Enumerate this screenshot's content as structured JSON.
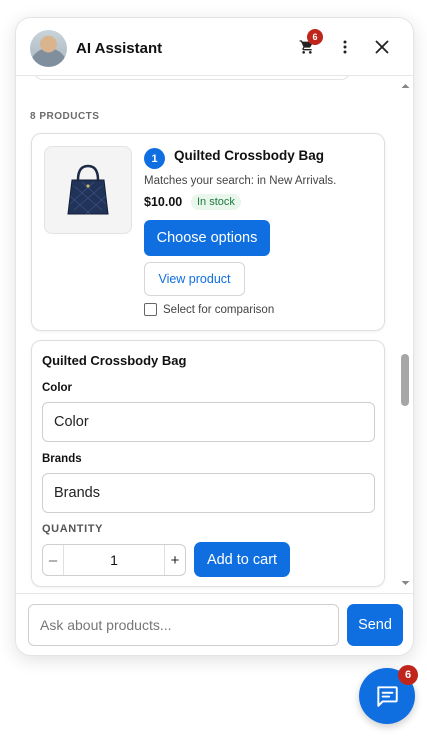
{
  "header": {
    "title": "AI Assistant",
    "cart_count": "6",
    "icons": [
      "avatar",
      "cart-icon",
      "more-vertical-icon",
      "close-icon"
    ]
  },
  "results": {
    "count_label": "8 PRODUCTS"
  },
  "product": {
    "index": "1",
    "name": "Quilted Crossbody Bag",
    "match_text": "Matches your search: in New Arrivals.",
    "price": "$10.00",
    "stock_status": "In stock",
    "choose_label": "Choose options",
    "view_label": "View product",
    "compare_label": "Select for comparison"
  },
  "options": {
    "title": "Quilted Crossbody Bag",
    "color_label": "Color",
    "color_value": "Color",
    "brands_label": "Brands",
    "brands_value": "Brands",
    "quantity_label": "QUANTITY",
    "decrement": "–",
    "quantity_value": "1",
    "increment": "+",
    "add_label": "Add to cart"
  },
  "composer": {
    "placeholder": "Ask about products...",
    "send_label": "Send"
  },
  "launcher": {
    "badge": "6"
  },
  "colors": {
    "accent": "#0f6fe0",
    "badge": "#c0251b",
    "stock_text": "#1f7a3e",
    "stock_bg": "#e8f6ec"
  }
}
